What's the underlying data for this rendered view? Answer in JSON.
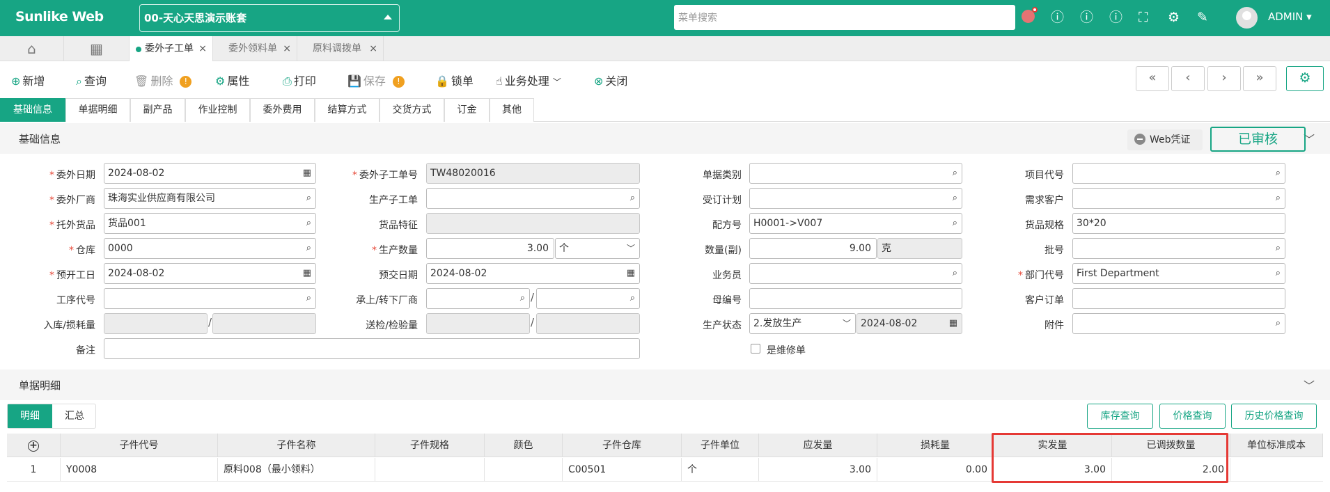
{
  "app": {
    "brand": "Sunlike Web",
    "account": "00-天心天思演示账套",
    "search_placeholder": "菜单搜索",
    "user": "ADMIN"
  },
  "page_tabs": [
    {
      "label": "委外子工单",
      "active": true
    },
    {
      "label": "委外领料单"
    },
    {
      "label": "原料调拨单"
    }
  ],
  "toolbar": {
    "new": "新增",
    "query": "查询",
    "delete": "删除",
    "props": "属性",
    "print": "打印",
    "save": "保存",
    "lock": "锁单",
    "business": "业务处理",
    "close": "关闭"
  },
  "pager": [
    "«",
    "‹",
    "›",
    "»"
  ],
  "form_tabs": [
    "基础信息",
    "单据明细",
    "副产品",
    "作业控制",
    "委外费用",
    "结算方式",
    "交货方式",
    "订金",
    "其他"
  ],
  "basic": {
    "title": "基础信息",
    "web_voucher": "Web凭证",
    "status": "已审核"
  },
  "form": {
    "date_label": "委外日期",
    "date": "2024-08-02",
    "order_no_label": "委外子工单号",
    "order_no": "TW48020016",
    "doc_type_label": "单据类别",
    "doc_type": "",
    "project_label": "项目代号",
    "project": "",
    "vendor_label": "委外厂商",
    "vendor": "珠海实业供应商有限公司",
    "sub_order_label": "生产子工单",
    "sub_order": "",
    "plan_label": "受订计划",
    "plan": "",
    "demand_customer_label": "需求客户",
    "demand_customer": "",
    "goods_label": "托外货品",
    "goods": "货品001",
    "goods_feature_label": "货品特征",
    "goods_feature": "",
    "formula_label": "配方号",
    "formula": "H0001->V007",
    "goods_spec_label": "货品规格",
    "goods_spec": "30*20",
    "warehouse_label": "仓库",
    "warehouse": "0000",
    "qty_label": "生产数量",
    "qty": "3.00",
    "qty_unit": "个",
    "qty2_label": "数量(副)",
    "qty2": "9.00",
    "qty2_unit": "克",
    "batch_label": "批号",
    "batch": "",
    "start_label": "预开工日",
    "start": "2024-08-02",
    "delivery_label": "预交日期",
    "delivery": "2024-08-02",
    "salesman_label": "业务员",
    "salesman": "",
    "dept_label": "部门代号",
    "dept": "First Department",
    "process_label": "工序代号",
    "process": "",
    "transfer_label": "承上/转下厂商",
    "parent_label": "母编号",
    "parent": "",
    "customer_order_label": "客户订单",
    "customer_order": "",
    "stock_loss_label": "入库/损耗量",
    "inspect_label": "送检/检验量",
    "prod_status_label": "生产状态",
    "prod_status": "2.发放生产",
    "prod_status_date": "2024-08-02",
    "attach_label": "附件",
    "attach": "",
    "remark_label": "备注",
    "remark": "",
    "repair_label": "是维修单"
  },
  "detail": {
    "title": "单据明细",
    "tabs": [
      "明细",
      "汇总"
    ],
    "buttons": [
      "库存查询",
      "价格查询",
      "历史价格查询"
    ]
  },
  "grid": {
    "columns": [
      "子件代号",
      "子件名称",
      "子件规格",
      "颜色",
      "子件仓库",
      "子件单位",
      "应发量",
      "损耗量",
      "实发量",
      "已调拨数量",
      "单位标准成本"
    ],
    "rows": [
      {
        "no": "1",
        "code": "Y0008",
        "name": "原料008（最小领料）",
        "spec": "",
        "color": "",
        "warehouse": "C00501",
        "unit": "个",
        "due": "3.00",
        "loss": "0.00",
        "actual": "3.00",
        "transferred": "2.00",
        "std_cost": ""
      }
    ]
  },
  "colors": {
    "accent": "#17a584",
    "highlight": "#e53935",
    "required": "#e74c3c"
  }
}
